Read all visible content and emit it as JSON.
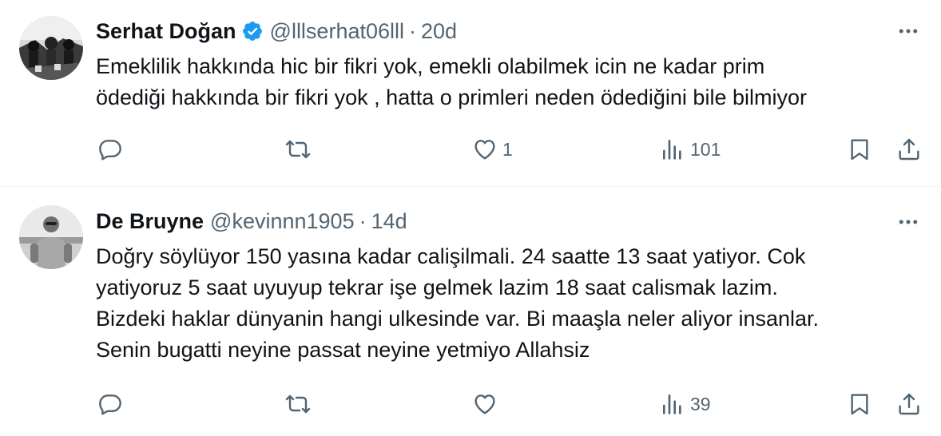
{
  "tweets": [
    {
      "name": "Serhat Doğan",
      "verified": true,
      "handle": "@lllserhat06lll",
      "separator": "·",
      "time": "20d",
      "lines": [
        "Emeklilik hakkında hic bir fikri yok, emekli olabilmek icin ne kadar prim",
        "ödediği hakkında bir fikri yok , hatta o primleri neden ödediğini bile bilmiyor"
      ],
      "likes": "1",
      "views": "101"
    },
    {
      "name": "De Bruyne",
      "verified": false,
      "handle": "@kevinnn1905",
      "separator": "·",
      "time": "14d",
      "lines": [
        "Doğry söylüyor 150 yasına kadar calişilmali. 24 saatte 13 saat yatiyor. Cok",
        "yatiyoruz 5 saat uyuyup tekrar işe gelmek lazim 18 saat calismak lazim.",
        "Bizdeki haklar dünyanin hangi ulkesinde var. Bi maaşla neler aliyor insanlar.",
        "Senin bugatti neyine passat neyine yetmiyo Allahsiz"
      ],
      "likes": "",
      "views": "39"
    }
  ],
  "colors": {
    "text": "#0f1419",
    "secondary": "#536471",
    "verified": "#1d9bf0",
    "divider": "#eff3f4"
  },
  "icons": [
    "reply-icon",
    "retweet-icon",
    "like-icon",
    "views-icon",
    "bookmark-icon",
    "share-icon",
    "more-icon",
    "verified-icon"
  ]
}
